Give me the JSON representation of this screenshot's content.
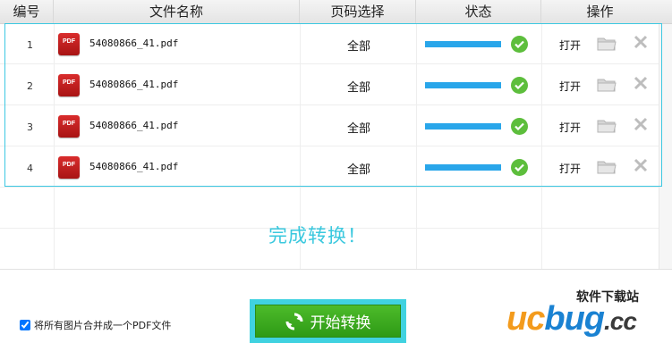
{
  "table": {
    "headers": [
      "编号",
      "文件名称",
      "页码选择",
      "状态",
      "操作"
    ],
    "rows": [
      {
        "index": "1",
        "file_badge": "PDF",
        "file_name": "54080866_41.pdf",
        "page_range": "全部",
        "progress": 1.0,
        "open_label": "打开"
      },
      {
        "index": "2",
        "file_badge": "PDF",
        "file_name": "54080866_41.pdf",
        "page_range": "全部",
        "progress": 1.0,
        "open_label": "打开"
      },
      {
        "index": "3",
        "file_badge": "PDF",
        "file_name": "54080866_41.pdf",
        "page_range": "全部",
        "progress": 1.0,
        "open_label": "打开"
      },
      {
        "index": "4",
        "file_badge": "PDF",
        "file_name": "54080866_41.pdf",
        "page_range": "全部",
        "progress": 1.0,
        "open_label": "打开"
      }
    ],
    "icons": {
      "status": "check-circle-icon",
      "folder": "folder-icon",
      "remove": "close-icon"
    }
  },
  "status_message": "完成转换！",
  "options": {
    "merge_label": "将所有图片合并成一个PDF文件",
    "merge_checked": true
  },
  "start_button": {
    "label": "开始转换",
    "icon": "refresh-icon"
  },
  "watermark": {
    "top_text": "软件下载站",
    "brand_part1": "uc",
    "brand_part2": "bug",
    "brand_part3": ".cc"
  },
  "colors": {
    "accent": "#3ac8de",
    "progress": "#29a6ea",
    "success": "#5dbe3c",
    "button": "#3aab20",
    "pdf_red": "#c62020"
  }
}
